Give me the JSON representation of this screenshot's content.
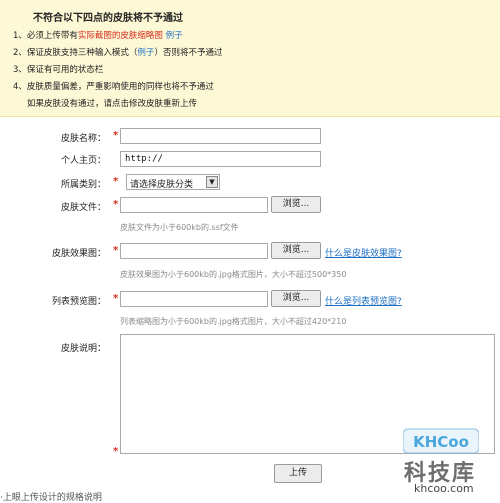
{
  "notice": {
    "title": "不符合以下四点的皮肤将不予通过",
    "line1_pre": "1、必须上传带有",
    "line1_red": "实际截图的皮肤缩略图",
    "line1_link": "例子",
    "line2_pre": "2、保证皮肤支持三种输入模式（",
    "line2_link": "例子",
    "line2_post": "）否则将不予通过",
    "line3": "3、保证有可用的状态栏",
    "line4": "4、皮肤质量偏差，严重影响使用的同样也将不予通过",
    "line5": "如果皮肤没有通过，请点击修改皮肤重新上传"
  },
  "form": {
    "required_mark": "*",
    "skin_name": {
      "label": "皮肤名称：",
      "value": ""
    },
    "homepage": {
      "label": "个人主页：",
      "value": "http://"
    },
    "category": {
      "label": "所属类别：",
      "selected": "请选择皮肤分类"
    },
    "skin_file": {
      "label": "皮肤文件：",
      "browse": "浏览...",
      "hint": "皮肤文件为小于600kb的.ssf文件"
    },
    "effect_image": {
      "label": "皮肤效果图：",
      "browse": "浏览...",
      "link": "什么是皮肤效果图?",
      "hint": "皮肤效果图为小于600kb的.jpg格式图片，大小不超过500*350"
    },
    "list_preview": {
      "label": "列表预览图：",
      "browse": "浏览...",
      "link": "什么是列表预览图?",
      "hint": "列表缩略图为小于600kb的.jpg格式图片，大小不超过420*210"
    },
    "description": {
      "label": "皮肤说明："
    },
    "upload_button": "上传"
  },
  "footer_text": "·上眼上传设计的规格说明",
  "watermark": {
    "logo": "KHCoo",
    "name": "科技库",
    "domain": "khcoo.com"
  }
}
